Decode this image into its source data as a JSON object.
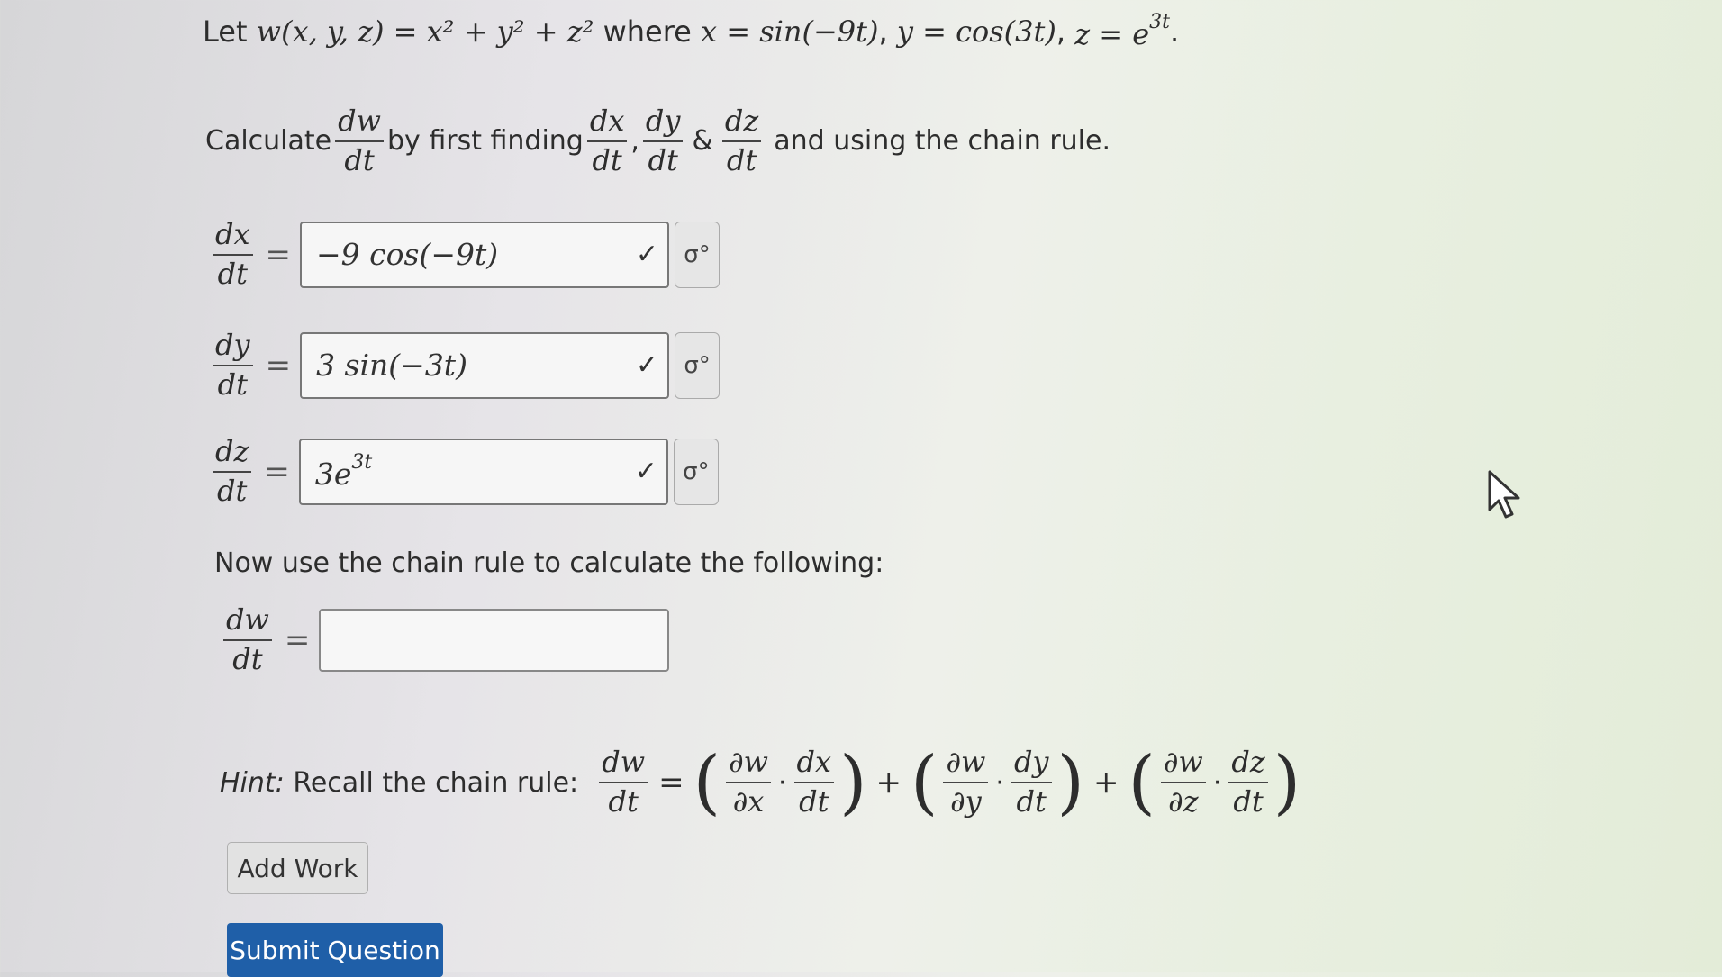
{
  "problem": {
    "let_text": "Let",
    "func": "w(x, y, z) = x² + y² + z²",
    "where_text": "where",
    "x_def": "x = sin(−9t)",
    "sep1": ",",
    "y_def": "y = cos(3t)",
    "sep2": ",",
    "z_def_base": "z = e",
    "z_def_exp": "3t",
    "end": "."
  },
  "instruction": {
    "calculate": "Calculate",
    "dw": "dw",
    "dt": "dt",
    "by_first_finding": "by first finding",
    "dx": "dx",
    "dy": "dy",
    "dz": "dz",
    "comma": ",",
    "amp": "&",
    "and_using": "and using the chain rule."
  },
  "derivatives": [
    {
      "num": "dx",
      "den": "dt",
      "value": "−9 cos(−9t)",
      "exp": ""
    },
    {
      "num": "dy",
      "den": "dt",
      "value": "3 sin(−3t)",
      "exp": ""
    },
    {
      "num": "dz",
      "den": "dt",
      "value": "3e",
      "exp": "3t"
    }
  ],
  "eq_sign": "=",
  "check_glyph": "✓",
  "gear_glyph": "σ°",
  "now_text": "Now use the chain rule to calculate the following:",
  "final": {
    "num": "dw",
    "den": "dt",
    "value": ""
  },
  "hint": {
    "label": "Hint:",
    "text": "Recall the chain rule:",
    "lhs_num": "dw",
    "lhs_den": "dt",
    "px_num": "∂w",
    "px_den": "∂x",
    "dx_num": "dx",
    "dx_den": "dt",
    "py_num": "∂w",
    "py_den": "∂y",
    "dy_num": "dy",
    "dy_den": "dt",
    "pz_num": "∂w",
    "pz_den": "∂z",
    "dz_num": "dz",
    "dz_den": "dt",
    "plus": "+",
    "dot": "·",
    "lparen": "(",
    "rparen": ")"
  },
  "buttons": {
    "add_work": "Add Work",
    "submit": "Submit Question"
  },
  "icons": {
    "check": "check-icon",
    "gear": "formula-editor-icon",
    "cursor": "mouse-cursor-icon"
  }
}
